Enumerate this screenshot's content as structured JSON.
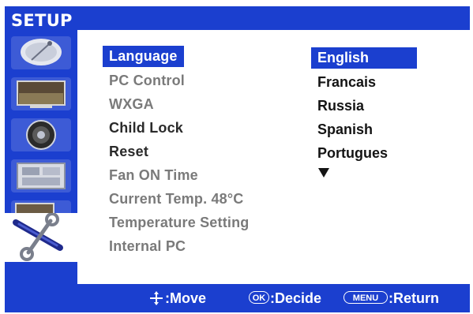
{
  "window": {
    "title": "SETUP"
  },
  "sidebar": {
    "icons": [
      {
        "name": "satellite-dish-icon"
      },
      {
        "name": "picture-icon"
      },
      {
        "name": "speaker-icon"
      },
      {
        "name": "window-icon"
      },
      {
        "name": "pc-monitor-icon"
      },
      {
        "name": "tools-icon",
        "selected": true
      }
    ]
  },
  "menu": {
    "items": [
      {
        "label": "Language",
        "state": "selected"
      },
      {
        "label": "PC Control",
        "state": "disabled"
      },
      {
        "label": "WXGA",
        "state": "disabled"
      },
      {
        "label": "Child Lock",
        "state": "active"
      },
      {
        "label": "Reset",
        "state": "active"
      },
      {
        "label": "Fan ON Time",
        "state": "disabled"
      },
      {
        "label": "Current Temp. 48°C",
        "state": "disabled"
      },
      {
        "label": "Temperature Setting",
        "state": "disabled"
      },
      {
        "label": "Internal PC",
        "state": "disabled"
      }
    ]
  },
  "languages": {
    "options": [
      "English",
      "Francais",
      "Russia",
      "Spanish",
      "Portugues"
    ],
    "selected": "English",
    "more_indicator": "down-arrow-icon"
  },
  "footer": {
    "move_label": ":Move",
    "ok_key": "OK",
    "decide_label": ":Decide",
    "menu_key": "MENU",
    "return_label": ":Return"
  },
  "colors": {
    "accent": "#1b3fcf",
    "background": "#ffffff",
    "text_dark": "#141414",
    "text_disabled": "#7a7a7a"
  }
}
